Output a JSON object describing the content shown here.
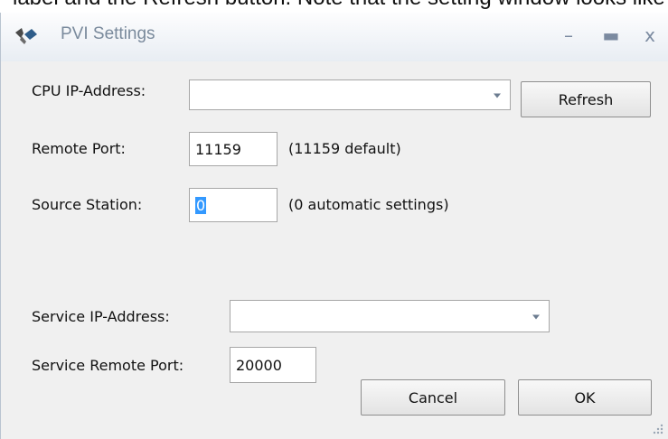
{
  "caption": "label and the Refresh button. Note that the setting window looks like following",
  "window": {
    "title": "PVI Settings"
  },
  "form": {
    "cpu_ip_label": "CPU IP-Address:",
    "cpu_ip_value": "",
    "refresh_label": "Refresh",
    "remote_port_label": "Remote Port:",
    "remote_port_value": "11159",
    "remote_port_hint": "(11159 default)",
    "source_station_label": "Source Station:",
    "source_station_value": "0",
    "source_station_hint": "(0 automatic settings)",
    "service_ip_label": "Service IP-Address:",
    "service_ip_value": "",
    "service_port_label": "Service Remote Port:",
    "service_port_value": "20000",
    "cancel_label": "Cancel",
    "ok_label": "OK"
  },
  "colors": {
    "accent": "#3399ff",
    "title_text": "#7a8a9c"
  }
}
